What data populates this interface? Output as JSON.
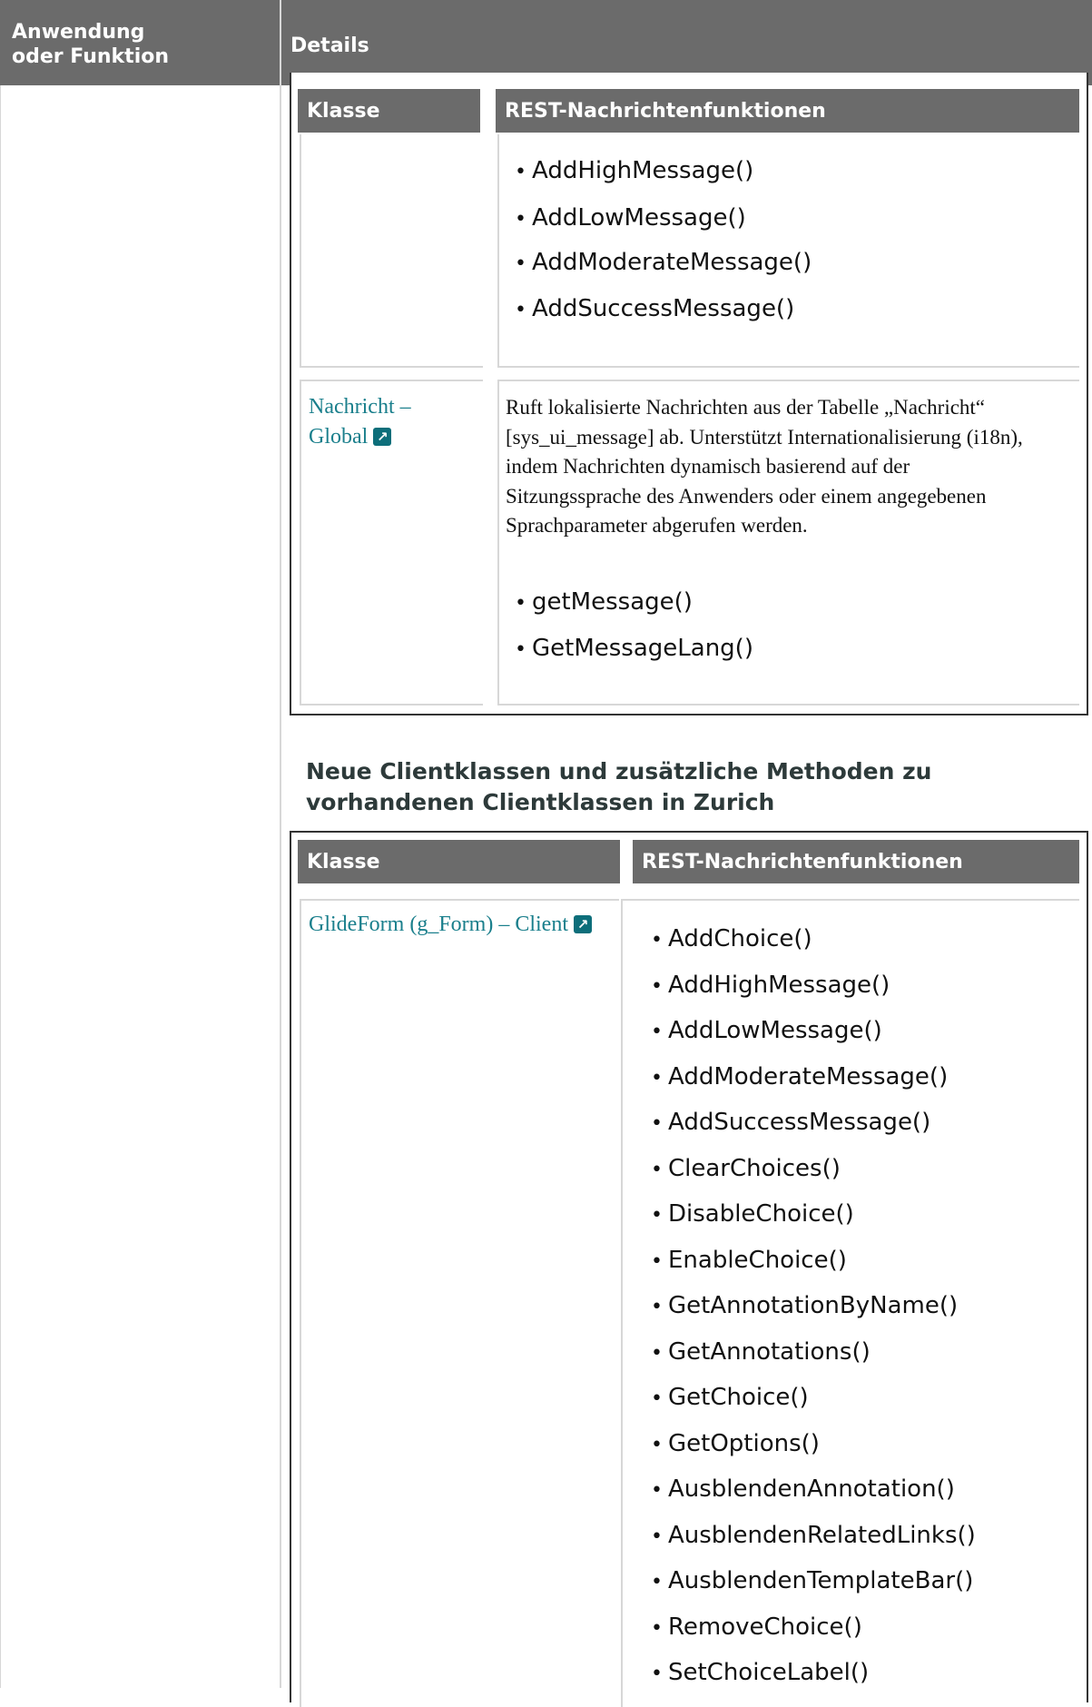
{
  "outer_table": {
    "col1_header": "Anwendung oder Funktion",
    "col2_header": "Details"
  },
  "table1": {
    "col_class": "Klasse",
    "col_functions": "REST-Nachrichtenfunktionen",
    "rows": [
      {
        "class_link": "",
        "methods": [
          "AddHighMessage()",
          "AddLowMessage()",
          "AddModerateMessage()",
          "AddSuccessMessage()"
        ]
      },
      {
        "class_link": "Nachricht – Global",
        "description": "Ruft lokalisierte Nachrichten aus der Tabelle „Nachricht“ [sys_ui_message] ab. Unterstützt Internationalisierung (i18n), indem Nachrichten dynamisch basierend auf der Sitzungssprache des Anwenders oder einem angegebenen Sprachparameter abgerufen werden.",
        "methods": [
          "getMessage()",
          "GetMessageLang()"
        ]
      }
    ]
  },
  "section_heading": "Neue Clientklassen und zusätzliche Methoden zu vorhandenen Clientklassen in Zurich",
  "table2": {
    "col_class": "Klasse",
    "col_functions": "REST-Nachrichtenfunktionen",
    "rows": [
      {
        "class_link": "GlideForm (g_Form) – Client",
        "methods": [
          "AddChoice()",
          "AddHighMessage()",
          "AddLowMessage()",
          "AddModerateMessage()",
          "AddSuccessMessage()",
          "ClearChoices()",
          "DisableChoice()",
          "EnableChoice()",
          "GetAnnotationByName()",
          "GetAnnotations()",
          "GetChoice()",
          "GetOptions()",
          "AusblendenAnnotation()",
          "AusblendenRelatedLinks()",
          "AusblendenTemplateBar()",
          "RemoveChoice()",
          "SetChoiceLabel()"
        ]
      }
    ]
  },
  "icons": {
    "external_link": "external-link-icon"
  }
}
